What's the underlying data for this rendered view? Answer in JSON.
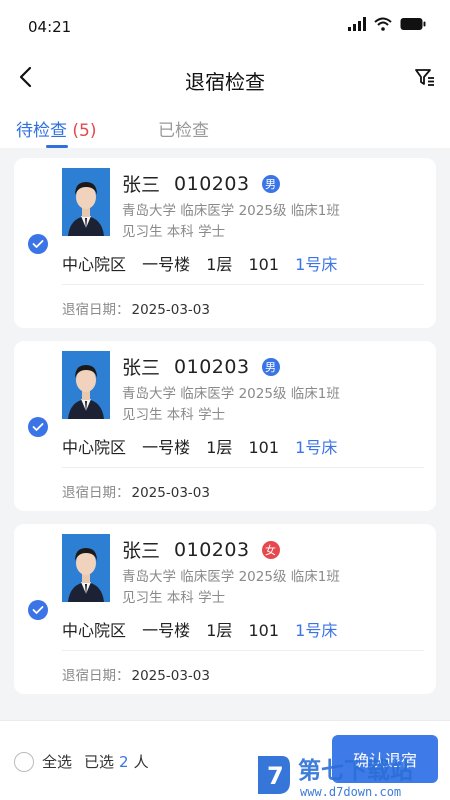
{
  "status_bar": {
    "time": "04:21"
  },
  "header": {
    "title": "退宿检查"
  },
  "tabs": {
    "pending_label": "待检查",
    "pending_count": "(5)",
    "done_label": "已检查"
  },
  "records": [
    {
      "name": "张三",
      "student_id": "010203",
      "gender": "男",
      "info_line1": "青岛大学 临床医学 2025级 临床1班",
      "info_line2": "见习生 本科 学士",
      "campus": "中心院区",
      "building": "一号楼",
      "floor": "1层",
      "room": "101",
      "bed": "1号床",
      "date_label": "退宿日期：",
      "date": "2025-03-03"
    },
    {
      "name": "张三",
      "student_id": "010203",
      "gender": "男",
      "info_line1": "青岛大学 临床医学 2025级 临床1班",
      "info_line2": "见习生 本科 学士",
      "campus": "中心院区",
      "building": "一号楼",
      "floor": "1层",
      "room": "101",
      "bed": "1号床",
      "date_label": "退宿日期：",
      "date": "2025-03-03"
    },
    {
      "name": "张三",
      "student_id": "010203",
      "gender": "女",
      "info_line1": "青岛大学 临床医学 2025级 临床1班",
      "info_line2": "见习生 本科 学士",
      "campus": "中心院区",
      "building": "一号楼",
      "floor": "1层",
      "room": "101",
      "bed": "1号床",
      "date_label": "退宿日期：",
      "date": "2025-03-03"
    }
  ],
  "footer": {
    "select_all_label": "全选",
    "selected_prefix": "已选",
    "selected_count": "2",
    "selected_suffix": "人",
    "confirm_label": "确认退宿"
  },
  "watermark": {
    "text": "第七下载站",
    "url_text": "www.d7down.com"
  },
  "colors": {
    "accent": "#3b74e6",
    "female": "#e5484d",
    "pending_count": "#e5484d"
  }
}
